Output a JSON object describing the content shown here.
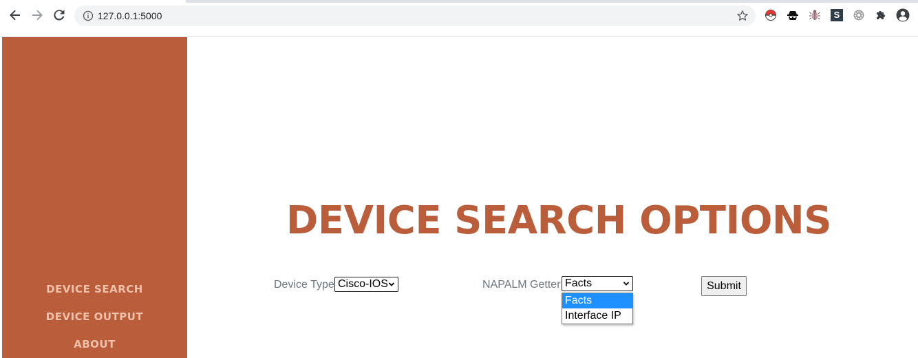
{
  "browser": {
    "url": "127.0.0.1:5000",
    "icons": [
      "back-icon",
      "forward-icon",
      "reload-icon",
      "info-icon",
      "bookmark-star-icon",
      "pokeball-extension-icon",
      "spy-extension-icon",
      "bug-extension-icon",
      "s-extension-icon",
      "gear-extension-icon",
      "puzzle-extensions-icon",
      "profile-icon"
    ],
    "s_ext_letter": "S"
  },
  "sidebar": {
    "items": [
      {
        "label": "DEVICE SEARCH"
      },
      {
        "label": "DEVICE OUTPUT"
      },
      {
        "label": "ABOUT"
      }
    ],
    "color": "#b95d3a"
  },
  "main": {
    "title": "DEVICE SEARCH OPTIONS",
    "device_type": {
      "label": "Device Type",
      "value": "Cisco-IOS"
    },
    "napalm_getter": {
      "label": "NAPALM Getter",
      "value": "Facts",
      "options": [
        "Facts",
        "Interface IP"
      ],
      "highlighted": "Facts"
    },
    "submit_label": "Submit"
  }
}
